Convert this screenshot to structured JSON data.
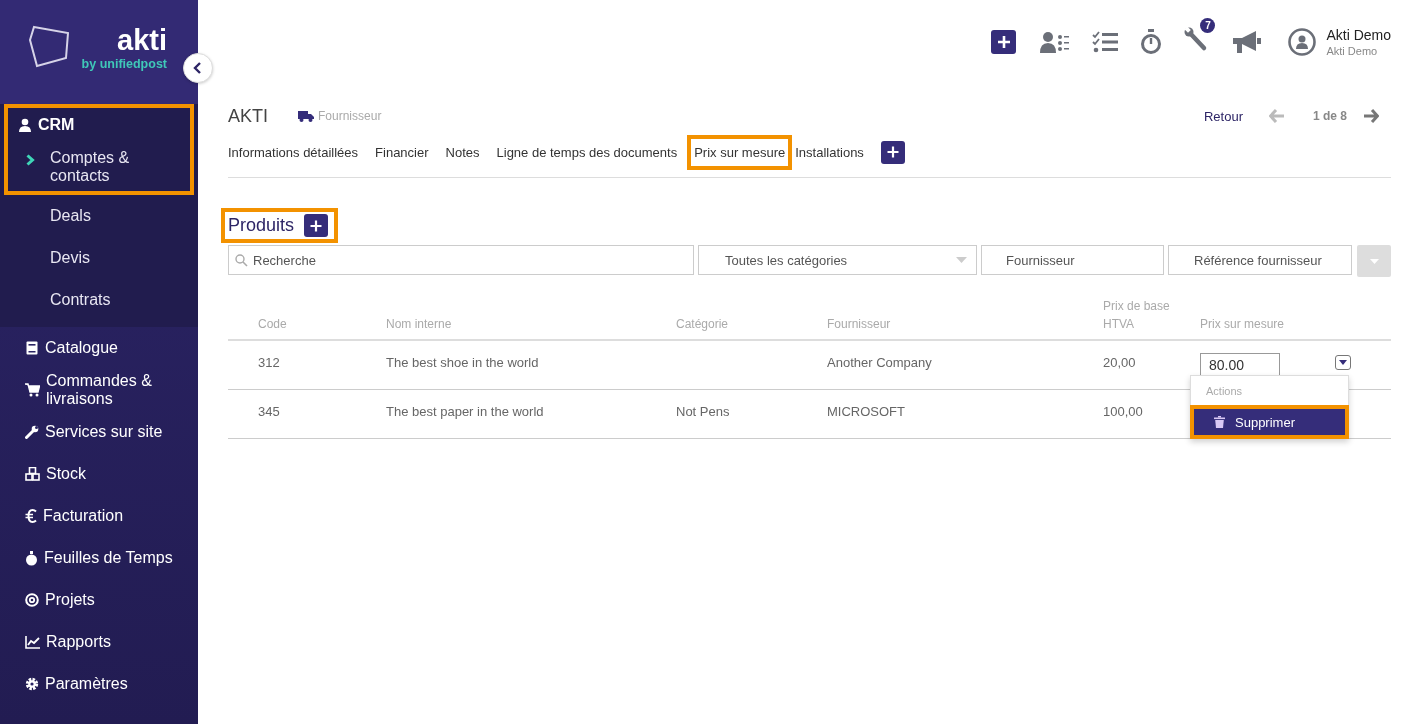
{
  "logo": {
    "name": "akti",
    "tagline": "by unifiedpost"
  },
  "sidebar": {
    "items": [
      {
        "label": "CRM",
        "highlighted": true,
        "children": [
          {
            "label": "Comptes & contacts",
            "selected": true
          },
          {
            "label": "Deals",
            "selected": false
          },
          {
            "label": "Devis",
            "selected": false
          },
          {
            "label": "Contrats",
            "selected": false
          }
        ]
      },
      {
        "label": "Catalogue",
        "highlighted": false
      },
      {
        "label": "Commandes & livraisons",
        "highlighted": false
      },
      {
        "label": "Services sur site",
        "highlighted": false
      },
      {
        "label": "Stock",
        "highlighted": false
      },
      {
        "label": "Facturation",
        "highlighted": false
      },
      {
        "label": "Feuilles de Temps",
        "highlighted": false
      },
      {
        "label": "Projets",
        "highlighted": false
      },
      {
        "label": "Rapports",
        "highlighted": false
      },
      {
        "label": "Paramètres",
        "highlighted": false
      }
    ]
  },
  "topbar": {
    "badge": "7",
    "user": {
      "name": "Akti Demo",
      "company": "Akti Demo"
    }
  },
  "record": {
    "title": "AKTI",
    "type": "Fournisseur",
    "back": "Retour",
    "pager": "1 de 8"
  },
  "tabs": [
    {
      "label": "Informations détaillées",
      "highlighted": false
    },
    {
      "label": "Financier",
      "highlighted": false
    },
    {
      "label": "Notes",
      "highlighted": false
    },
    {
      "label": "Ligne de temps des documents",
      "highlighted": false
    },
    {
      "label": "Prix sur mesure",
      "highlighted": true
    },
    {
      "label": "Installations",
      "highlighted": false
    }
  ],
  "section": {
    "title": "Produits",
    "highlighted": true
  },
  "filters": {
    "search": {
      "placeholder": "Recherche"
    },
    "category": {
      "value": "Toutes les catégories"
    },
    "supplier": {
      "placeholder": "Fournisseur"
    },
    "reference": {
      "placeholder": "Référence fournisseur"
    }
  },
  "table": {
    "columns": [
      "Code",
      "Nom interne",
      "Catégorie",
      "Fournisseur",
      "Prix de base HTVA",
      "Prix sur mesure"
    ],
    "rows": [
      {
        "code": "312",
        "name": "The best shoe in the world",
        "category": "",
        "supplier": "Another Company",
        "base_price": "20,00",
        "custom_price": "80.00",
        "menu_open": true
      },
      {
        "code": "345",
        "name": "The best paper in the world",
        "category": "Not Pens",
        "supplier": "MICROSOFT",
        "base_price": "100,00",
        "menu_open": false
      }
    ]
  },
  "menu": {
    "header": "Actions",
    "items": [
      {
        "label": "Supprimer",
        "highlighted": true
      }
    ]
  }
}
